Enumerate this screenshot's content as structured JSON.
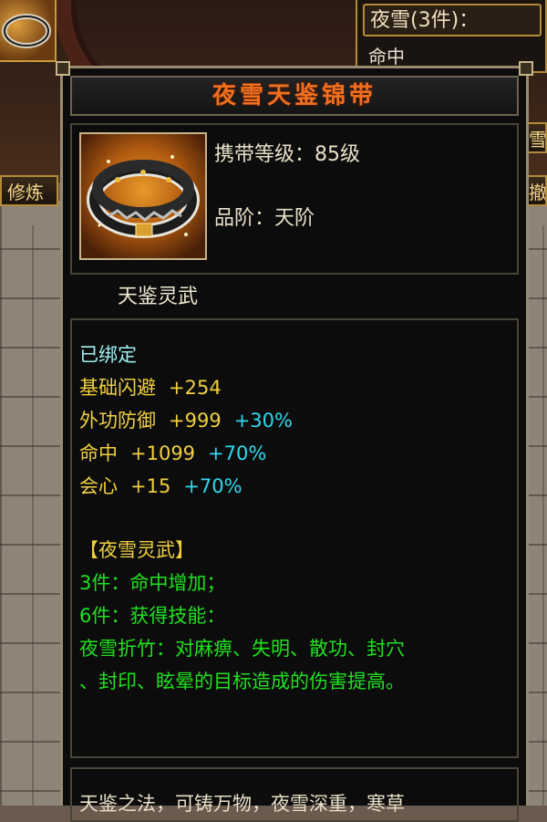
{
  "set_panel": {
    "title": "夜雪(3件)：",
    "row": "命中"
  },
  "side_tabs": {
    "left": "修炼",
    "right_top": "雪",
    "right": "撤"
  },
  "tooltip": {
    "title": "夜雪天鉴锦带",
    "level_label": "携带等级：85级",
    "grade_label": "品阶：天阶",
    "weapon_type": "天鉴灵武",
    "bound": "已绑定",
    "stats": [
      {
        "name": "基础闪避",
        "value": "+254",
        "bonus": ""
      },
      {
        "name": "外功防御",
        "value": "+999",
        "bonus": "+30%"
      },
      {
        "name": "命中",
        "value": "+1099",
        "bonus": "+70%"
      },
      {
        "name": "会心",
        "value": "+15",
        "bonus": "+70%"
      }
    ],
    "set_name": "【夜雪灵武】",
    "set_3": "3件：命中增加；",
    "set_6": "6件：获得技能：",
    "skill_line1": "夜雪折竹：对麻痹、失明、散功、封穴",
    "skill_line2": "、封印、眩晕的目标造成的伤害提高。",
    "bottom_text": "天鉴之法，可铸万物，夜雪深重，寒草"
  },
  "colors": {
    "title": "#f07020",
    "stat_name": "#f0d040",
    "bonus": "#30d8f0",
    "set": "#20e020",
    "bound": "#9ef0f0"
  },
  "icons": {
    "item": "belt-icon",
    "top_item": "belt-icon"
  }
}
